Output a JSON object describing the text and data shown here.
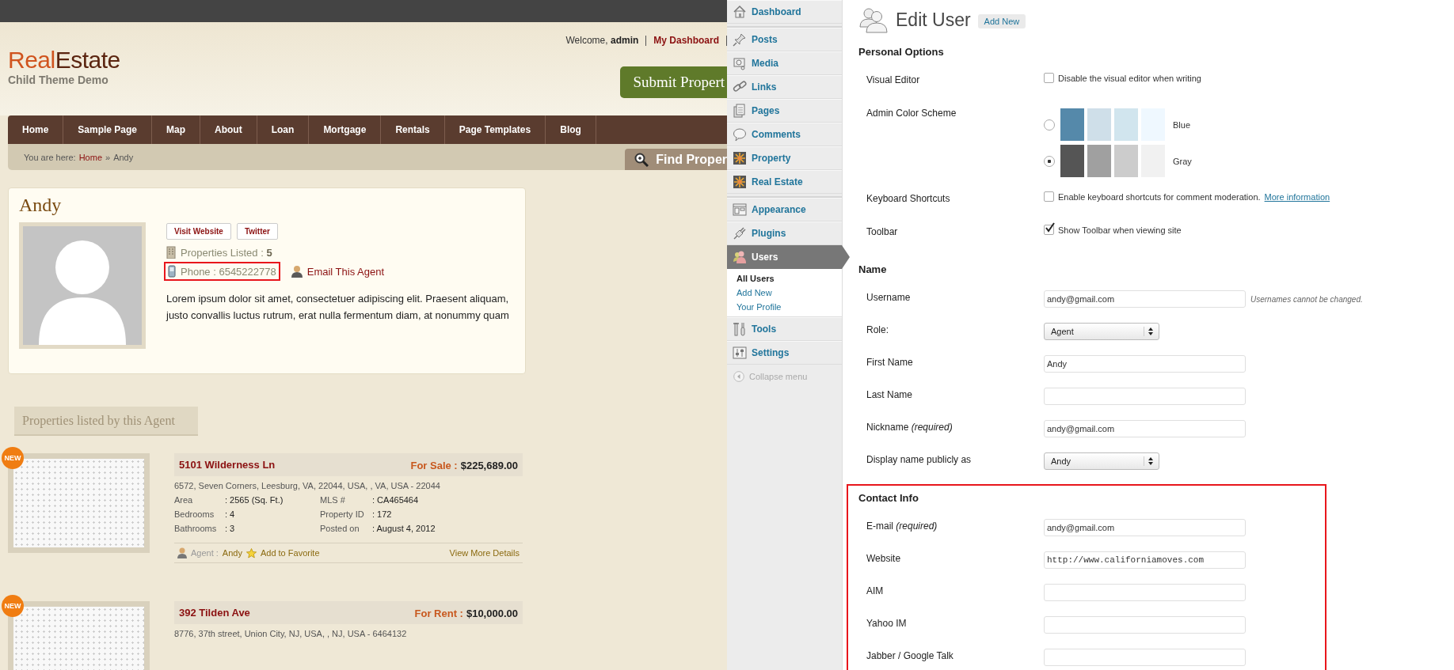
{
  "site": {
    "header": {
      "logo_first": "Real",
      "logo_second": "Estate",
      "tagline": "Child Theme Demo",
      "welcome": "Welcome, **admin**",
      "dashboard_link": "My Dashboard",
      "submit_button": "Submit Propert"
    },
    "nav": [
      "Home",
      "Sample Page",
      "Map",
      "About",
      "Loan",
      "Mortgage",
      "Rentals",
      "Page Templates",
      "Blog"
    ],
    "breadcrumb": {
      "label": "You are here:",
      "home": "Home",
      "separator": "»",
      "current": "Andy"
    },
    "find_button": "Find Proper",
    "agent": {
      "name": "Andy",
      "buttons": [
        "Visit Website",
        "Twitter"
      ],
      "properties": "Properties Listed : **5**",
      "phone": "Phone : 6545222778",
      "phone_highlighted": true,
      "email_link": "Email This Agent",
      "bio": "Lorem ipsum dolor sit amet, consectetuer adipiscing elit. Praesent aliquam, justo convallis luctus rutrum, erat nulla fermentum diam, at nonummy quam"
    },
    "listings_tab": "Properties listed by this Agent",
    "listings": [
      {
        "badge": "NEW",
        "title": "5101 Wilderness Ln",
        "status": "For Sale :",
        "price": "$225,689.00",
        "address": "6572, Seven Corners, Leesburg, VA, 22044, USA, , VA, USA - 22044",
        "fields": [
          {
            "label": "Area",
            "value": ": 2565 (Sq. Ft.)"
          },
          {
            "label": "MLS #",
            "value": ": CA465464"
          },
          {
            "label": "Bedrooms",
            "value": ": 4"
          },
          {
            "label": "Property ID",
            "value": ": 172"
          },
          {
            "label": "Bathrooms",
            "value": ": 3"
          },
          {
            "label": "Posted on",
            "value": ": August 4, 2012"
          }
        ],
        "agent_label": "Agent :",
        "agent": "Andy",
        "favorite": "Add to Favorite",
        "details": "View More Details"
      },
      {
        "badge": "NEW",
        "title": "392 Tilden Ave",
        "status": "For Rent :",
        "price": "$10,000.00",
        "address": "8776, 37th street, Union City, NJ, USA, , NJ, USA - 6464132"
      }
    ]
  },
  "admin": {
    "menu": [
      {
        "label": "Dashboard",
        "selected": false,
        "separator_after": true
      },
      {
        "label": "Posts",
        "selected": false,
        "separator_after": false
      },
      {
        "label": "Media",
        "selected": false,
        "separator_after": false
      },
      {
        "label": "Links",
        "selected": false,
        "separator_after": false
      },
      {
        "label": "Pages",
        "selected": false,
        "separator_after": false
      },
      {
        "label": "Comments",
        "selected": false,
        "separator_after": false
      },
      {
        "label": "Property",
        "selected": false,
        "separator_after": false
      },
      {
        "label": "Real Estate",
        "selected": false,
        "separator_after": true
      },
      {
        "label": "Appearance",
        "selected": false,
        "separator_after": false
      },
      {
        "label": "Plugins",
        "selected": false,
        "separator_after": false
      },
      {
        "label": "Users",
        "selected": true,
        "separator_after": false,
        "submenu": [
          {
            "label": "All Users",
            "selected": true
          },
          {
            "label": "Add New",
            "selected": false
          },
          {
            "label": "Your Profile",
            "selected": false
          }
        ]
      },
      {
        "label": "Tools",
        "selected": false,
        "separator_after": false
      },
      {
        "label": "Settings",
        "selected": false,
        "separator_after": false
      }
    ],
    "collapse": "Collapse menu",
    "page_title": "Edit User",
    "add_new": "Add New",
    "sections": [
      {
        "heading": "Personal Options",
        "highlighted": false,
        "rows": [
          {
            "kind": "checkbox",
            "label": "Visual Editor",
            "checked": false,
            "text": "Disable the visual editor when writing"
          },
          {
            "kind": "color_scheme",
            "label": "Admin Color Scheme",
            "options": [
              {
                "name": "Blue",
                "selected": false,
                "swatches": [
                  {
                    "color": "#5589aa"
                  },
                  {
                    "color": "#cfdfe9"
                  },
                  {
                    "color": "#d1e5ee"
                  },
                  {
                    "color": "#eff8ff"
                  }
                ]
              },
              {
                "name": "Gray",
                "selected": true,
                "swatches": [
                  {
                    "color": "#555555"
                  },
                  {
                    "color": "#a0a0a0"
                  },
                  {
                    "color": "#cccccc"
                  },
                  {
                    "color": "#f1f1f1"
                  }
                ]
              }
            ]
          },
          {
            "kind": "checkbox",
            "label": "Keyboard Shortcuts",
            "checked": false,
            "text": "Enable keyboard shortcuts for comment moderation.",
            "link": "More information"
          },
          {
            "kind": "checkbox",
            "label": "Toolbar",
            "checked": true,
            "text": "Show Toolbar when viewing site"
          }
        ]
      },
      {
        "heading": "Name",
        "highlighted": false,
        "rows": [
          {
            "kind": "text",
            "label": "Username",
            "value": "andy@gmail.com",
            "hint": "Usernames cannot be changed."
          },
          {
            "kind": "select",
            "label": "Role:",
            "value": "Agent"
          },
          {
            "kind": "text",
            "label": "First Name",
            "value": "Andy"
          },
          {
            "kind": "text",
            "label": "Last Name",
            "value": ""
          },
          {
            "kind": "text",
            "label": "Nickname *(required)*",
            "value": "andy@gmail.com"
          },
          {
            "kind": "select",
            "label": "Display name publicly as",
            "value": "Andy"
          }
        ]
      },
      {
        "heading": "Contact Info",
        "highlighted": true,
        "rows": [
          {
            "kind": "text",
            "label": "E-mail *(required)*",
            "value": "andy@gmail.com"
          },
          {
            "kind": "url",
            "label": "Website",
            "value": "http://www.californiamoves.com"
          },
          {
            "kind": "text",
            "label": "AIM",
            "value": ""
          },
          {
            "kind": "text",
            "label": "Yahoo IM",
            "value": ""
          },
          {
            "kind": "text",
            "label": "Jabber / Google Talk",
            "value": ""
          }
        ]
      }
    ]
  }
}
